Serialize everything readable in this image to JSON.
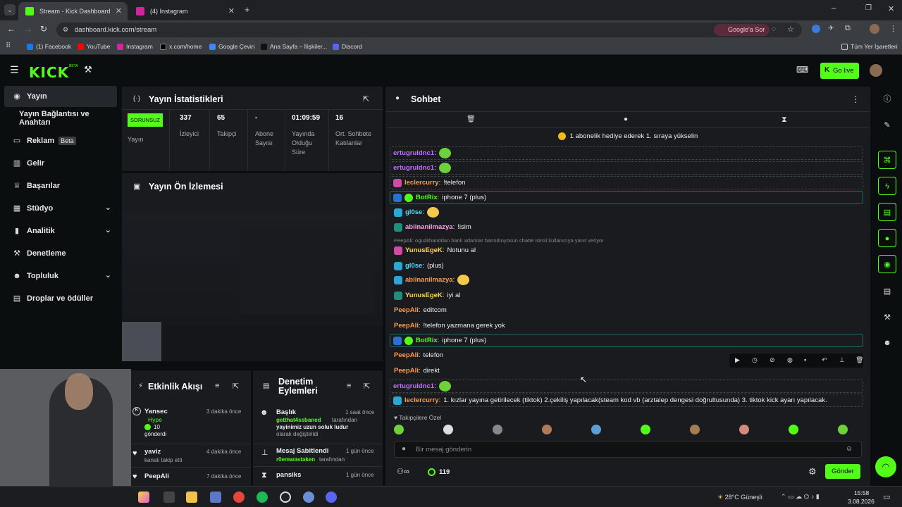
{
  "browser": {
    "tabs": [
      {
        "title": "Stream - Kick Dashboard",
        "active": true
      },
      {
        "title": "(4) Instagram",
        "active": false
      }
    ],
    "url": "dashboard.kick.com/stream",
    "google_btn": "Google'a Sor",
    "bookmarks": [
      "(1) Facebook",
      "YouTube",
      "Instagram",
      "x.com/home",
      "Google Çeviri",
      "Ana Sayfa – İlişkiler...",
      "Discord"
    ],
    "all_bookmarks": "Tüm Yer İşaretleri"
  },
  "header": {
    "logo": "KICK",
    "go_live": "Go live"
  },
  "sidebar": {
    "items": [
      {
        "label": "Yayın",
        "icon": "broadcast-icon",
        "active": true
      },
      {
        "label": "Yayın Bağlantısı ve Anahtarı"
      },
      {
        "label": "Reklam",
        "badge": "Beta",
        "icon": "ad-icon"
      },
      {
        "label": "Gelir",
        "icon": "revenue-icon"
      },
      {
        "label": "Başarılar",
        "icon": "trophy-icon"
      },
      {
        "label": "Stüdyo",
        "icon": "studio-icon",
        "chevron": true
      },
      {
        "label": "Analitik",
        "icon": "analytics-icon",
        "chevron": true
      },
      {
        "label": "Denetleme",
        "icon": "wrench-icon"
      },
      {
        "label": "Topluluk",
        "icon": "community-icon",
        "chevron": true
      },
      {
        "label": "Droplar ve ödüller",
        "icon": "drops-icon"
      }
    ]
  },
  "stats": {
    "title": "Yayın İstatistikleri",
    "status_badge": "SORUNSUZ",
    "status_label": "Yayın",
    "items": [
      {
        "value": "337",
        "label": "İzleyici"
      },
      {
        "value": "65",
        "label": "Takipçi"
      },
      {
        "value": "-",
        "label": "Abone Sayısı"
      },
      {
        "value": "01:09:59",
        "label": "Yayında Olduğu Süre"
      },
      {
        "value": "16",
        "label": "Ort. Sohbete Katılanlar"
      }
    ]
  },
  "preview": {
    "title": "Yayın Ön İzlemesi"
  },
  "activity": {
    "title": "Etkinlik Akışı",
    "items": [
      {
        "user": "Yansec",
        "time": "3 dakika önce",
        "detail1": "Hype",
        "detail2": "10",
        "detail3": "gönderdi"
      },
      {
        "user": "yaviz",
        "time": "4 dakika önce",
        "detail1": "kanalı takip etti"
      },
      {
        "user": "PeepAli",
        "time": "7 dakika önce"
      }
    ]
  },
  "moderation": {
    "title": "Denetim Eylemleri",
    "items": [
      {
        "title": "Başlık",
        "time": "1 saat önce",
        "user": "getthat4ssbaned",
        "text1": "tarafından",
        "text2": "yayinimiz uzun soluk ludur",
        "text3": "olarak değiştirildi"
      },
      {
        "title": "Mesaj Sabitlendi",
        "time": "1 gün önce",
        "user": "r0emwastaken",
        "text1": "tarafından"
      },
      {
        "title": "pansiks",
        "time": "1 gün önce"
      }
    ]
  },
  "chat": {
    "title": "Sohbet",
    "promo": "1 abonelik hediye ederek 1. sıraya yükselin",
    "messages": [
      {
        "user": "ertugruldnc1",
        "text": "",
        "color": "#c86bff",
        "emote": true,
        "boxed": true
      },
      {
        "user": "ertugruldnc1",
        "text": "",
        "color": "#c86bff",
        "emote": true,
        "boxed": true
      },
      {
        "user": "leclercurry",
        "text": "!telefon",
        "color": "#ff9c4a",
        "boxed": true
      },
      {
        "user": "BotRix",
        "text": "iphone 7 (plus)",
        "color": "#53fc18",
        "bot": true
      },
      {
        "user": "gl0se",
        "text": "",
        "color": "#4fd8ff",
        "emote": true
      },
      {
        "user": "abiinanilmazya",
        "text": "!isim",
        "color": "#ff9ce6"
      },
      {
        "user": "YunusEgeK",
        "text": "Notunu al",
        "color": "#ffd84a",
        "reply": "PeepAli: oguzkhanddan banlı adamlar banndınyosun chatte isimli kullanıcıya yanıt veriyor"
      },
      {
        "user": "gl0se",
        "text": "(plus)",
        "color": "#4fd8ff"
      },
      {
        "user": "abiinanilmazya",
        "text": "",
        "color": "#ff9c4a",
        "emote": true
      },
      {
        "user": "YunusEgeK",
        "text": "iyi al",
        "color": "#ffd84a"
      },
      {
        "user": "PeepAli",
        "text": "editcom",
        "color": "#ff9c4a"
      },
      {
        "user": "PeepAli",
        "text": "!telefon yazmana gerek yok",
        "color": "#ff9c4a"
      },
      {
        "user": "BotRix",
        "text": "iphone 7 (plus)",
        "color": "#53fc18",
        "bot": true
      },
      {
        "user": "PeepAli",
        "text": "telefon",
        "color": "#ff9c4a"
      },
      {
        "user": "PeepAli",
        "text": "direkt",
        "color": "#ff9c4a"
      },
      {
        "user": "ertugruldnc1",
        "text": "",
        "color": "#c86bff",
        "emote": true,
        "boxed": true
      },
      {
        "user": "leclercurry",
        "text": "1. kızlar yayına getirilecek (tiktok) 2.çekiliş yapılacak(steam kod vb (arztalep dengesi doğrultusunda) 3. tiktok kick ayarı yapılacak.",
        "color": "#ff9c4a",
        "boxed": true
      }
    ],
    "followers_label": "Takipçilere Özel",
    "input_placeholder": "Bir mesaj gönderin",
    "points": "119",
    "send": "Gönder"
  },
  "taskbar": {
    "weather": "28°C Güneşli",
    "time": "15:58",
    "date": "3.08.2026"
  }
}
